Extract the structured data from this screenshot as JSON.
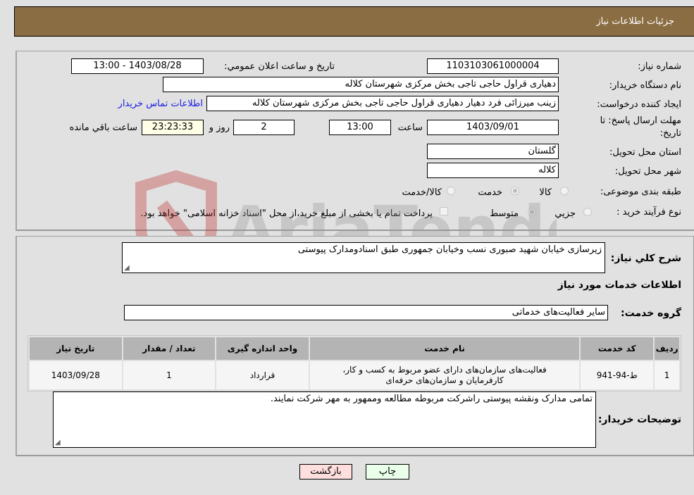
{
  "header": {
    "title": "جزئیات اطلاعات نیاز"
  },
  "info": {
    "need_number_label": "شماره نیاز:",
    "need_number": "1103103061000004",
    "announce_label": "تاریخ و ساعت اعلان عمومي:",
    "announce_value": "1403/08/28 - 13:00",
    "buyer_org_label": "نام دستگاه خریدار:",
    "buyer_org": "دهیاری قراول حاجی تاجی بخش مرکزی شهرستان کلاله",
    "creator_label": "ایجاد کننده درخواست:",
    "creator": "زینب میرزائی فرد دهیار دهیاری قراول حاجی تاجی بخش مرکزی شهرستان کلاله",
    "contact_link": "اطلاعات تماس خریدار",
    "deadline_label_line1": "مهلت ارسال پاسخ: تا",
    "deadline_label_line2": "تاریخ:",
    "deadline_date": "1403/09/01",
    "time_label": "ساعت",
    "deadline_time": "13:00",
    "days_remaining": "2",
    "days_label": "روز و",
    "time_remaining": "23:23:33",
    "remaining_label": "ساعت باقي مانده",
    "province_label": "استان محل تحویل:",
    "province": "گلستان",
    "city_label": "شهر محل تحویل:",
    "city": "کلاله",
    "category_label": "طبقه بندی موضوعی:",
    "category_options": [
      {
        "label": "کالا",
        "checked": false
      },
      {
        "label": "خدمت",
        "checked": true
      },
      {
        "label": "کالا/خدمت",
        "checked": false
      }
    ],
    "process_label": "نوع فرآیند خرید :",
    "process_options": [
      {
        "label": "جزیي",
        "checked": false
      },
      {
        "label": "متوسط",
        "checked": true
      }
    ],
    "treasury_checkbox_checked": false,
    "treasury_text": "پرداخت تمام یا بخشی از مبلغ خرید،از محل \"اسناد خزانه اسلامی\" خواهد بود."
  },
  "details": {
    "description_label": "شرح كلي نیاز:",
    "description": "زیرسازی خیابان شهید صبوری نسب وخیابان جمهوری طبق اسنادومدارک پیوستی",
    "services_heading": "اطلاعات خدمات مورد نیاز",
    "service_group_label": "گروه خدمت:",
    "service_group": "سایر فعالیت‌های خدماتی",
    "table": {
      "headers": [
        "ردیف",
        "کد خدمت",
        "نام خدمت",
        "واحد اندازه گیری",
        "تعداد / مقدار",
        "تاریخ نیاز"
      ],
      "rows": [
        {
          "row": "1",
          "code": "ط-94-941",
          "name_line1": "فعالیت‌های سازمان‌های دارای عضو مربوط به کسب و کار،",
          "name_line2": "کارفرمایان و سازمان‌های حرفه‌ای",
          "unit": "قرارداد",
          "qty": "1",
          "date": "1403/09/28"
        }
      ]
    },
    "buyer_notes_label": "توضیحات خریدار:",
    "buyer_notes": "تمامی مدارک ونقشه پیوستی راشرکت مربوطه مطالعه وممهور به مهر شرکت نمایند."
  },
  "buttons": {
    "print": "چاپ",
    "back": "بازگشت"
  },
  "watermark": {
    "text": "AriaTender.net"
  },
  "colors": {
    "header_bg": "#8b6d43",
    "print_bg": "#eaffea",
    "back_bg": "#ffdede",
    "link": "#1a1ae6"
  }
}
